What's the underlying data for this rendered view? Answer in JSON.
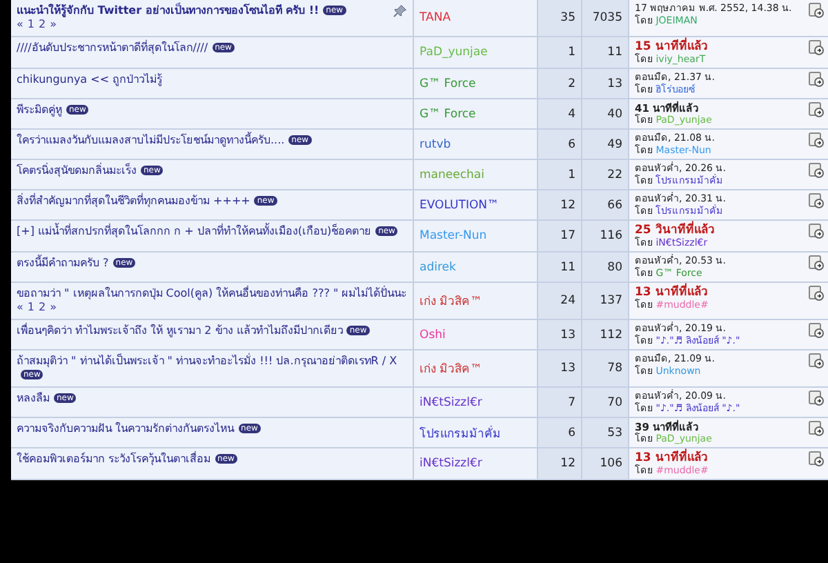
{
  "threads": [
    {
      "title": "แนะนำให้รู้จักกับ Twitter อย่างเป็นทางการของโซนไอที ครับ !!",
      "sticky": true,
      "badge": "new",
      "pages": [
        "«",
        "1",
        "2",
        "»"
      ],
      "author": {
        "name": "TANA",
        "color": "#e0303e"
      },
      "replies": "35",
      "views": "7035",
      "last": {
        "time": "17 พฤษภาคม พ.ศ. 2552, 14.38 น.",
        "kind": "plain",
        "by": "โดย",
        "user": {
          "name": "JOEIMAN",
          "color": "#33aa66"
        }
      }
    },
    {
      "title": "////อันดับประชากรหน้าตาดีที่สุดในโลก////",
      "sticky": false,
      "badge": "new",
      "author": {
        "name": "PaD_yunjae",
        "color": "#66bb44"
      },
      "replies": "1",
      "views": "11",
      "last": {
        "time": "15 นาทีที่แล้ว",
        "kind": "recent",
        "by": "โดย",
        "user": {
          "name": "iviy_hearT",
          "color": "#44aa55"
        }
      }
    },
    {
      "title": "chikungunya << ถูกป่าวไม่รู้",
      "sticky": false,
      "author": {
        "name": "G™ Force",
        "color": "#339933"
      },
      "replies": "2",
      "views": "13",
      "last": {
        "time": "ตอนมืด, 21.37 น.",
        "kind": "plain",
        "by": "โดย",
        "user": {
          "name": "ฮิโร่บอยซ์",
          "color": "#3366dd"
        }
      }
    },
    {
      "title": "พีระมิดคู่หู",
      "sticky": false,
      "badge": "new",
      "author": {
        "name": "G™ Force",
        "color": "#339933"
      },
      "replies": "4",
      "views": "40",
      "last": {
        "time": "41 นาทีที่แล้ว",
        "kind": "bold",
        "by": "โดย",
        "user": {
          "name": "PaD_yunjae",
          "color": "#66bb44"
        }
      }
    },
    {
      "title": "ใครว่าแมลงวันกับแมลงสาบไม่มีประโยชน์มาดูทางนี้ครับ....",
      "sticky": false,
      "badge": "new",
      "author": {
        "name": "rutvb",
        "color": "#3366cc"
      },
      "replies": "6",
      "views": "49",
      "last": {
        "time": "ตอนมืด, 21.08 น.",
        "kind": "plain",
        "by": "โดย",
        "user": {
          "name": "Master-Nun",
          "color": "#3399ee"
        }
      }
    },
    {
      "title": "โคตรนิ่งสุนัขดมกลิ่นมะเร็ง",
      "sticky": false,
      "badge": "new",
      "author": {
        "name": "maneechai",
        "color": "#66aa33"
      },
      "replies": "1",
      "views": "22",
      "last": {
        "time": "ตอนหัวค่ำ, 20.26 น.",
        "kind": "plain",
        "by": "โดย",
        "user": {
          "name": "โปรแกรมม้าคั่ม",
          "color": "#4433cc"
        }
      }
    },
    {
      "title": "สิ่งที่สำคัญมากที่สุดในชีวิตที่ทุกคนมองข้าม ++++",
      "sticky": false,
      "badge": "new",
      "author": {
        "name": "EVOLUTION™",
        "color": "#3333cc"
      },
      "replies": "12",
      "views": "66",
      "last": {
        "time": "ตอนหัวค่ำ, 20.31 น.",
        "kind": "plain",
        "by": "โดย",
        "user": {
          "name": "โปรแกรมม้าคั่ม",
          "color": "#4433cc"
        }
      }
    },
    {
      "title": "[+] แม่น้ำที่สกปรกที่สุดในโลกกก ก + ปลาที่ทำให้คนทั้งเมือง(เกือบ)ช็อคตาย",
      "sticky": false,
      "badge": "new",
      "author": {
        "name": "Master-Nun",
        "color": "#3399ee"
      },
      "replies": "17",
      "views": "116",
      "last": {
        "time": "25 วินาทีที่แล้ว",
        "kind": "recent",
        "by": "โดย",
        "user": {
          "name": "iN€tSizzl€r",
          "color": "#6633cc"
        }
      }
    },
    {
      "title": "ตรงนี้มีคำถามครับ ?",
      "sticky": false,
      "badge": "new",
      "author": {
        "name": "adirek",
        "color": "#3399dd"
      },
      "replies": "11",
      "views": "80",
      "last": {
        "time": "ตอนหัวค่ำ, 20.53 น.",
        "kind": "plain",
        "by": "โดย",
        "user": {
          "name": "G™ Force",
          "color": "#339933"
        }
      }
    },
    {
      "title": "ขอถามว่า \" เหตุผลในการกดปุ่ม Cool(คูล) ให้คนอื่นของท่านคือ ??? \" ผมไม่ได้ปั่นนะ",
      "sticky": false,
      "pages": [
        "«",
        "1",
        "2",
        "»"
      ],
      "author": {
        "name": "เก่ง มิวสิค™",
        "color": "#cc3333"
      },
      "replies": "24",
      "views": "137",
      "last": {
        "time": "13 นาทีที่แล้ว",
        "kind": "recent",
        "by": "โดย",
        "user": {
          "name": "#muddle#",
          "color": "#ee66aa"
        }
      }
    },
    {
      "title": "เพื่อนๆคิดว่า ทำไมพระเจ้าถึง ให้ หูเรามา 2 ข้าง แล้วทำไมถึงมีปากเดียว",
      "sticky": false,
      "badge": "new",
      "author": {
        "name": "Oshi",
        "color": "#ee3399"
      },
      "replies": "13",
      "views": "112",
      "last": {
        "time": "ตอนหัวค่ำ, 20.19 น.",
        "kind": "plain",
        "by": "โดย",
        "user": {
          "name": "\"♪.\"♬ ลิงน้อยส์ \"♪.\"",
          "color": "#4433cc"
        }
      }
    },
    {
      "title": "ถ้าสมมุติว่า \" ท่านได้เป็นพระเจ้า \" ท่านจะทำอะไรมั่ง !!! ปล.กรุณาอย่าติดเรทR / X",
      "sticky": false,
      "badge": "new",
      "author": {
        "name": "เก่ง มิวสิค™",
        "color": "#cc3333"
      },
      "replies": "13",
      "views": "78",
      "last": {
        "time": "ตอนมืด, 21.09 น.",
        "kind": "plain",
        "by": "โดย",
        "user": {
          "name": "Unknown",
          "color": "#3399dd"
        }
      }
    },
    {
      "title": "หลงลืม",
      "sticky": false,
      "badge": "new",
      "author": {
        "name": "iN€tSizzl€r",
        "color": "#6633cc"
      },
      "replies": "7",
      "views": "70",
      "last": {
        "time": "ตอนหัวค่ำ, 20.09 น.",
        "kind": "plain",
        "by": "โดย",
        "user": {
          "name": "\"♪.\"♬ ลิงน้อยส์ \"♪.\"",
          "color": "#4433cc"
        }
      }
    },
    {
      "title": "ความจริงกับความฝัน ในความรักต่างกันตรงไหน",
      "sticky": false,
      "badge": "new",
      "author": {
        "name": "โปรแกรมม้าคั่ม",
        "color": "#3333cc"
      },
      "replies": "6",
      "views": "53",
      "last": {
        "time": "39 นาทีที่แล้ว",
        "kind": "bold",
        "by": "โดย",
        "user": {
          "name": "PaD_yunjae",
          "color": "#66bb44"
        }
      }
    },
    {
      "title": "ใช้คอมพิวเตอร์มาก ระวังโรควุ้นในตาเสื่อม",
      "sticky": false,
      "badge": "new",
      "author": {
        "name": "iN€tSizzl€r",
        "color": "#6633cc"
      },
      "replies": "12",
      "views": "106",
      "last": {
        "time": "13 นาทีที่แล้ว",
        "kind": "recent",
        "by": "โดย",
        "user": {
          "name": "#muddle#",
          "color": "#ee66aa"
        }
      }
    }
  ]
}
